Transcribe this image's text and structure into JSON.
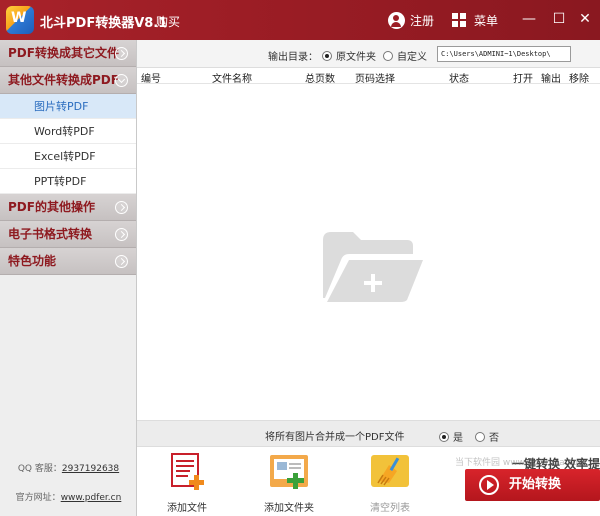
{
  "titlebar": {
    "logo_text": "W",
    "app_title": "北斗PDF转换器V8.1",
    "buy": "购买",
    "register": "注册",
    "menu": "菜单",
    "minimize": "—",
    "maximize": "☐",
    "close": "✕"
  },
  "sidebar": {
    "cat_pdf_to_other": "PDF转换成其它文件",
    "cat_other_to_pdf": "其他文件转换成PDF",
    "sub_items": [
      "图片转PDF",
      "Word转PDF",
      "Excel转PDF",
      "PPT转PDF"
    ],
    "cat_pdf_ops": "PDF的其他操作",
    "cat_ebook": "电子书格式转换",
    "cat_special": "特色功能",
    "qq_label": "QQ 客服：",
    "qq_value": "2937192638",
    "site_label": "官方网址：",
    "site_value": "www.pdfer.cn"
  },
  "output": {
    "label": "输出目录：",
    "option_source": "原文件夹",
    "option_custom": "自定义",
    "path": "C:\\Users\\ADMINI~1\\Desktop\\"
  },
  "table": {
    "columns": [
      "编号",
      "文件名称",
      "总页数",
      "页码选择",
      "状态",
      "打开",
      "输出",
      "移除"
    ]
  },
  "merge": {
    "text": "将所有图片合并成一个PDF文件",
    "yes": "是",
    "no": "否"
  },
  "toolbar": {
    "add_file": "添加文件",
    "add_folder": "添加文件夹",
    "clear_list": "清空列表",
    "slogan": "一键转换  效率提升",
    "start": "开始转换"
  },
  "watermark": "当下软件园 www.downxia.com",
  "colors": {
    "brand_red": "#9c1d25",
    "category_text": "#8e1a20",
    "active_sub_bg": "#d8e8f8",
    "active_sub_text": "#2b6dbf",
    "start_button": "#c81f26"
  }
}
